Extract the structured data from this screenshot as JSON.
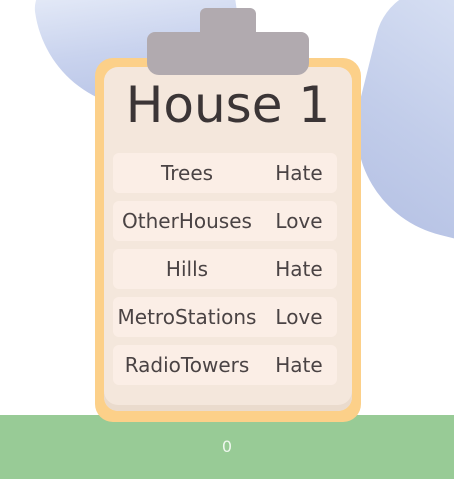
{
  "house": {
    "title": "House 1",
    "preferences": [
      {
        "item": "Trees",
        "feeling": "Hate"
      },
      {
        "item": "OtherHouses",
        "feeling": "Love"
      },
      {
        "item": "Hills",
        "feeling": "Hate"
      },
      {
        "item": "MetroStations",
        "feeling": "Love"
      },
      {
        "item": "RadioTowers",
        "feeling": "Hate"
      }
    ]
  },
  "score": "0",
  "colors": {
    "sky_shape": "#c9d3ee",
    "ground": "#98cb96",
    "clipboard": "#fcd089",
    "paper": "#f4e7dc",
    "clip": "#b1aaaf",
    "text": "#3b3536"
  }
}
